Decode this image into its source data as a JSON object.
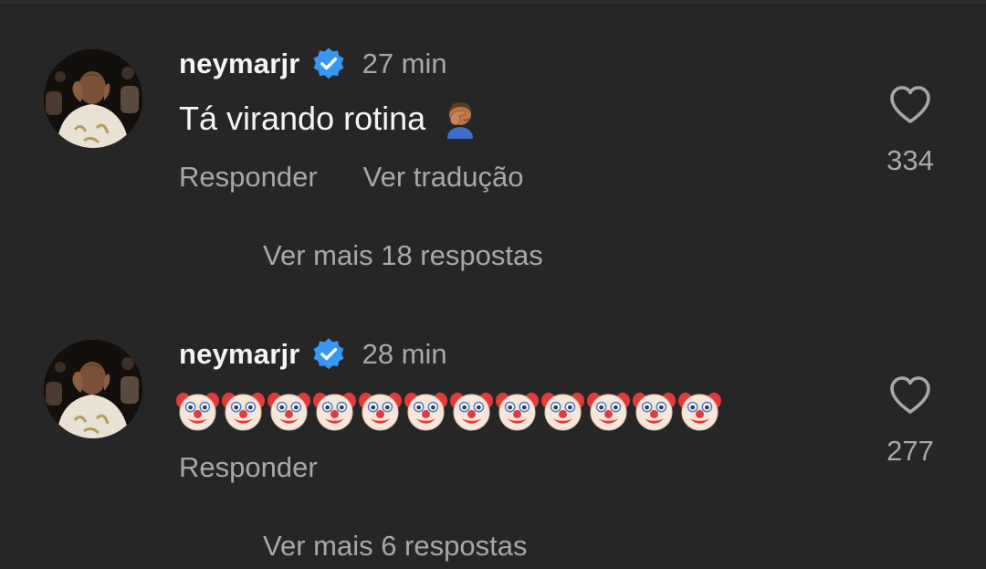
{
  "colors": {
    "background": "#262626",
    "primary_text": "#f5f5f5",
    "secondary_text": "#a8a8a8",
    "verified_badge": "#3897f0"
  },
  "comments": [
    {
      "username": "neymarjr",
      "verified_icon": "verified-badge-icon",
      "time": "27 min",
      "text": "Tá virando rotina",
      "emoji_icon": "facepalm-emoji",
      "actions": [
        "Responder",
        "Ver tradução"
      ],
      "like_icon": "heart-outline-icon",
      "likes": "334",
      "more_replies": "Ver mais 18 respostas"
    },
    {
      "username": "neymarjr",
      "verified_icon": "verified-badge-icon",
      "time": "28 min",
      "emoji_icon": "clown-face-emoji",
      "emoji_count": 12,
      "actions": [
        "Responder"
      ],
      "like_icon": "heart-outline-icon",
      "likes": "277",
      "more_replies": "Ver mais 6 respostas"
    }
  ]
}
